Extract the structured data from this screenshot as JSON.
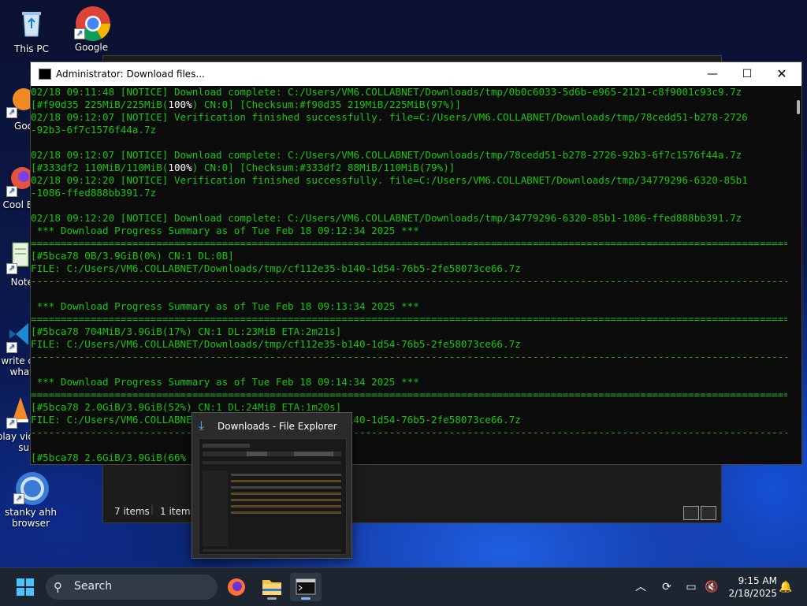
{
  "desktop": {
    "icons": [
      {
        "label": "This PC"
      },
      {
        "label": "Google"
      },
      {
        "label": "Goo"
      },
      {
        "label": "Cool B"
      },
      {
        "label": "Note"
      },
      {
        "label": "write c what"
      },
      {
        "label": "play vic sur"
      },
      {
        "label": "stanky ahh browser"
      }
    ]
  },
  "terminal": {
    "title": "Administrator: Download files...",
    "lines": [
      "02/18 09:11:48 [NOTICE] Download complete: C:/Users/VM6.COLLABNET/Downloads/tmp/0b0c6033-5d6b-e965-2121-c8f9001c93c9.7z",
      [
        "[#f90d35 225MiB/225MiB(",
        "100%",
        ") CN:0",
        "] [Checksum:#f90d35 219MiB/225MiB(97%)]"
      ],
      "02/18 09:12:07 [NOTICE] Verification finished successfully. file=C:/Users/VM6.COLLABNET/Downloads/tmp/78cedd51-b278-2726",
      "-92b3-6f7c1576f44a.7z",
      "",
      "02/18 09:12:07 [NOTICE] Download complete: C:/Users/VM6.COLLABNET/Downloads/tmp/78cedd51-b278-2726-92b3-6f7c1576f44a.7z",
      [
        "[#333df2 110MiB/110MiB(",
        "100%",
        ") CN:0",
        "] [Checksum:#333df2 88MiB/110MiB(79%)]"
      ],
      "02/18 09:12:20 [NOTICE] Verification finished successfully. file=C:/Users/VM6.COLLABNET/Downloads/tmp/34779296-6320-85b1",
      "-1086-ffed888bb391.7z",
      "",
      "02/18 09:12:20 [NOTICE] Download complete: C:/Users/VM6.COLLABNET/Downloads/tmp/34779296-6320-85b1-1086-ffed888bb391.7z",
      " *** Download Progress Summary as of Tue Feb 18 09:12:34 2025 ***",
      "===============================================================================================================================",
      "[#5bca78 0B/3.9GiB(0%) CN:1 DL:0B]",
      "FILE: C:/Users/VM6.COLLABNET/Downloads/tmp/cf112e35-b140-1d54-76b5-2fe58073ce66.7z",
      "-------------------------------------------------------------------------------------------------------------------------------",
      "",
      " *** Download Progress Summary as of Tue Feb 18 09:13:34 2025 ***",
      "===============================================================================================================================",
      "[#5bca78 704MiB/3.9GiB(17%) CN:1 DL:23MiB ETA:2m21s]",
      "FILE: C:/Users/VM6.COLLABNET/Downloads/tmp/cf112e35-b140-1d54-76b5-2fe58073ce66.7z",
      "-------------------------------------------------------------------------------------------------------------------------------",
      "",
      " *** Download Progress Summary as of Tue Feb 18 09:14:34 2025 ***",
      "===============================================================================================================================",
      "[#5bca78 2.0GiB/3.9GiB(52%) CN:1 DL:24MiB ETA:1m20s]",
      "FILE: C:/Users/VM6.COLLABNET/Downloads/tmp/cf112e35-b140-1d54-76b5-2fe58073ce66.7z",
      "-------------------------------------------------------------------------------------------------------------------------------",
      "",
      "[#5bca78 2.6GiB/3.9GiB(66%"
    ]
  },
  "explorer_back": {
    "items_count": "7 items",
    "selected": "1 item s"
  },
  "thumbnail": {
    "title": "Downloads - File Explorer"
  },
  "taskbar": {
    "search_label": "Search",
    "time": "9:15 AM",
    "date": "2/18/2025"
  }
}
